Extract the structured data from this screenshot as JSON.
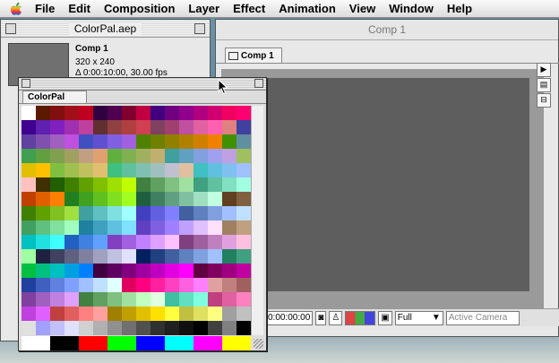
{
  "menubar": {
    "items": [
      "File",
      "Edit",
      "Composition",
      "Layer",
      "Effect",
      "Animation",
      "View",
      "Window",
      "Help"
    ]
  },
  "project_window": {
    "title": "ColorPal.aep",
    "item_name": "Comp 1",
    "item_size": "320 x 240",
    "item_duration": "Δ 0:00:10:00, 30.00 fps"
  },
  "comp_window": {
    "title": "Comp 1",
    "tab_label": "Comp 1",
    "timecode": "0:00:00:00",
    "resolution": "Full",
    "camera": "Active Camera"
  },
  "colorpal": {
    "tab_label": "ColorPal",
    "swatches": [
      "#ffffff",
      "#5a1a00",
      "#801010",
      "#a01018",
      "#c00020",
      "#300040",
      "#500050",
      "#800030",
      "#c00040",
      "#400080",
      "#700080",
      "#90008c",
      "#b00080",
      "#d00070",
      "#f00060",
      "#ff0070",
      "#400090",
      "#6020b0",
      "#8020c0",
      "#a030b0",
      "#c040a0",
      "#603030",
      "#904040",
      "#b04040",
      "#d04050",
      "#804060",
      "#a04070",
      "#c050a0",
      "#e060a0",
      "#ff60b0",
      "#e08080",
      "#4040a0",
      "#6040a0",
      "#8050b0",
      "#a060c0",
      "#c050e0",
      "#4050c0",
      "#6050d0",
      "#8060e0",
      "#a060e0",
      "#508000",
      "#708000",
      "#908000",
      "#b08000",
      "#d08000",
      "#f08000",
      "#409000",
      "#6090a0",
      "#40a050",
      "#60a040",
      "#80a050",
      "#a0a060",
      "#c0a080",
      "#e0a070",
      "#60b040",
      "#80b050",
      "#a0b060",
      "#c0b070",
      "#40a0a0",
      "#60a0c0",
      "#80a0e0",
      "#a0a0f0",
      "#c0a0e0",
      "#a0c060",
      "#e0c000",
      "#ffc000",
      "#80c040",
      "#a0c050",
      "#c0c060",
      "#e0c070",
      "#40c080",
      "#60c0a0",
      "#80c0b0",
      "#a0c0c0",
      "#c0c0d0",
      "#e0c0a0",
      "#40c0c0",
      "#60c0e0",
      "#80c0f0",
      "#a0c0ff",
      "#ffc0c0",
      "#403000",
      "#206000",
      "#408000",
      "#60a000",
      "#80c000",
      "#a0e000",
      "#c0ff00",
      "#408040",
      "#60a060",
      "#80c080",
      "#a0e0a0",
      "#40a080",
      "#60c0a0",
      "#80e0c0",
      "#a0ffe0",
      "#c04000",
      "#e06000",
      "#ff8000",
      "#208020",
      "#40a020",
      "#60c020",
      "#80e020",
      "#a0ff20",
      "#206040",
      "#408060",
      "#60a080",
      "#80c0a0",
      "#a0e0c0",
      "#c0ffe0",
      "#604020",
      "#806040",
      "#408000",
      "#60a000",
      "#80c020",
      "#a0e040",
      "#40a0a0",
      "#60c0c0",
      "#80e0e0",
      "#a0ffff",
      "#4040c0",
      "#6060e0",
      "#8080ff",
      "#4060a0",
      "#6080c0",
      "#80a0e0",
      "#a0c0ff",
      "#c0e0ff",
      "#40a060",
      "#60c080",
      "#80e0a0",
      "#a0ffc0",
      "#2080a0",
      "#40a0c0",
      "#60c0e0",
      "#80e0ff",
      "#6040c0",
      "#8060e0",
      "#a080ff",
      "#c0a0ff",
      "#e0c0ff",
      "#ffe0ff",
      "#a08060",
      "#c0a080",
      "#00c0c0",
      "#20e0e0",
      "#40ffff",
      "#2060c0",
      "#4080e0",
      "#60a0ff",
      "#8040c0",
      "#a060e0",
      "#c080ff",
      "#e0a0ff",
      "#ffc0ff",
      "#804080",
      "#a060a0",
      "#c080c0",
      "#e0a0e0",
      "#ffc0e0",
      "#a0ffa0",
      "#202040",
      "#404060",
      "#606080",
      "#8080a0",
      "#a0a0c0",
      "#c0c0e0",
      "#e0e0ff",
      "#002060",
      "#204080",
      "#4060a0",
      "#6080c0",
      "#80a0e0",
      "#a0c0ff",
      "#208060",
      "#40a080",
      "#00c040",
      "#00c080",
      "#00c0c0",
      "#00a0e0",
      "#0080ff",
      "#400040",
      "#600060",
      "#800080",
      "#a000a0",
      "#c000c0",
      "#e000e0",
      "#ff00ff",
      "#600040",
      "#800060",
      "#a00080",
      "#c000a0",
      "#2040a0",
      "#4060c0",
      "#6080e0",
      "#80a0ff",
      "#a0c0ff",
      "#c0e0ff",
      "#e0ffff",
      "#e00060",
      "#ff0080",
      "#ff20a0",
      "#ff40c0",
      "#ff60e0",
      "#ff80ff",
      "#e0a0a0",
      "#c08080",
      "#a06060",
      "#8040a0",
      "#a060c0",
      "#c080e0",
      "#e0a0ff",
      "#408040",
      "#60a060",
      "#80c080",
      "#a0e0a0",
      "#c0ffc0",
      "#e0ffe0",
      "#40c0a0",
      "#60e0c0",
      "#80ffe0",
      "#c04080",
      "#e060a0",
      "#ff80c0",
      "#c040e0",
      "#e060ff",
      "#c04040",
      "#e06060",
      "#ff8080",
      "#ffa0a0",
      "#a08000",
      "#c0a000",
      "#e0c000",
      "#ffe000",
      "#ffff40",
      "#c0c040",
      "#e0e060",
      "#ffff80",
      "#a0a0a0",
      "#c0c0c0",
      "#e0e0e0",
      "#a0a0ff",
      "#c0c0ff",
      "#e0e0ff",
      "#d0d0d0",
      "#b0b0b0",
      "#909090",
      "#707070",
      "#505050",
      "#303030",
      "#202020",
      "#101010",
      "#000000",
      "#404040",
      "#808080",
      "#000000"
    ],
    "primaries": [
      "#ffffff",
      "#000000",
      "#ff0000",
      "#00ff00",
      "#0000ff",
      "#00ffff",
      "#ff00ff",
      "#ffff00"
    ]
  }
}
